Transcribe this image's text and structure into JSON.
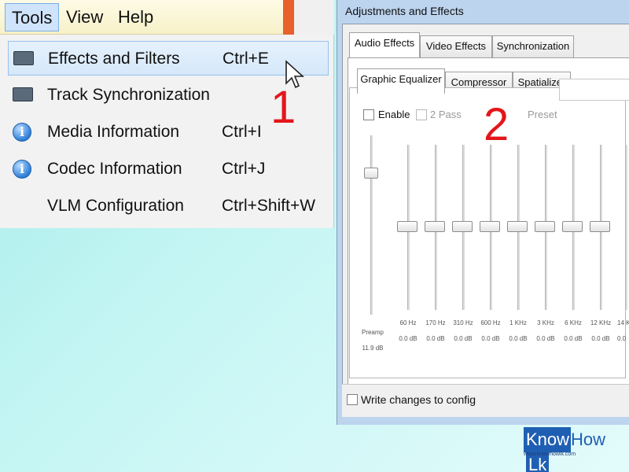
{
  "menubar": {
    "items": [
      "Tools",
      "View",
      "Help"
    ]
  },
  "tools_menu": {
    "items": [
      {
        "label": "Effects and Filters",
        "shortcut": "Ctrl+E",
        "icon": "equalizer-icon"
      },
      {
        "label": "Track Synchronization",
        "shortcut": "",
        "icon": "equalizer-icon"
      },
      {
        "label": "Media Information",
        "shortcut": "Ctrl+I",
        "icon": "info-icon"
      },
      {
        "label": "Codec Information",
        "shortcut": "Ctrl+J",
        "icon": "info-icon"
      },
      {
        "label": "VLM Configuration",
        "shortcut": "Ctrl+Shift+W",
        "icon": ""
      }
    ]
  },
  "annotations": {
    "step1": "1",
    "step2": "2"
  },
  "dialog": {
    "title": "Adjustments and Effects",
    "tabs": [
      "Audio Effects",
      "Video Effects",
      "Synchronization"
    ],
    "subtabs": [
      "Graphic Equalizer",
      "Compressor",
      "Spatializer"
    ],
    "enable_label": "Enable",
    "two_pass_label": "2 Pass",
    "preset_label": "Preset",
    "preamp": {
      "label": "Preamp",
      "value": "11.9 dB"
    },
    "bands": [
      {
        "freq": "60 Hz",
        "value": "0.0 dB"
      },
      {
        "freq": "170 Hz",
        "value": "0.0 dB"
      },
      {
        "freq": "310 Hz",
        "value": "0.0 dB"
      },
      {
        "freq": "600 Hz",
        "value": "0.0 dB"
      },
      {
        "freq": "1 KHz",
        "value": "0.0 dB"
      },
      {
        "freq": "3 KHz",
        "value": "0.0 dB"
      },
      {
        "freq": "6 KHz",
        "value": "0.0 dB"
      },
      {
        "freq": "12 KHz",
        "value": "0.0 dB"
      },
      {
        "freq": "14 K",
        "value": "0.0"
      }
    ],
    "write_config_label": "Write changes to config"
  },
  "logo": {
    "part1": "Know",
    "part2": "How",
    "part3": "Lk",
    "subtitle": "www.knowhowlk.com"
  },
  "colors": {
    "annotation": "#e4161b",
    "highlight": "#d5e8fa",
    "logo": "#1f5fb3"
  }
}
